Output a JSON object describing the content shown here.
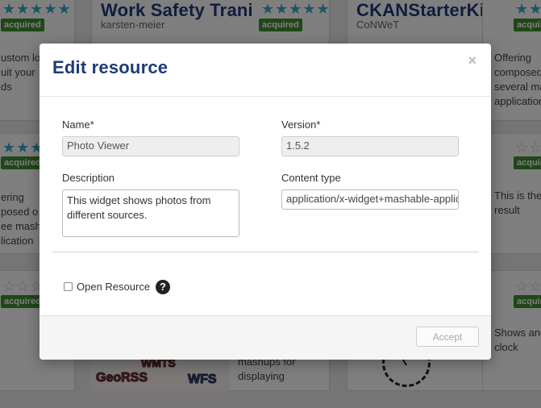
{
  "background": {
    "cards": [
      {
        "title": "Work Safety Traning",
        "vendor": "karsten-meier",
        "badge": "acquired"
      },
      {
        "title": "CKANStarterKit",
        "vendor": "CoNWeT",
        "badge": "acquired"
      }
    ],
    "badge_left": "acquired",
    "badge_far_right": "acquired",
    "row2_badge_left": "acquired",
    "row2_badge_right": "acquired",
    "row3_badge_left": "acquired",
    "row3_badge_right": "acquired",
    "desc_left_top": "ustom lo\nuit your\nds",
    "desc_right_top": "Offering\ncomposed\nseveral ma\napplication",
    "desc_left_mid": "ering\nposed o\nee mashu\nlication",
    "desc_right_mid": "This is the\nresult",
    "desc_center_bottom": "mashups for\ndisplaying",
    "desc_right_bottom": "Shows and\nclock",
    "thumb_words": [
      "WMTS",
      "GeoRSS",
      "WFS"
    ]
  },
  "modal": {
    "title": "Edit resource",
    "close": "×",
    "name_label": "Name*",
    "name_value": "Photo Viewer",
    "version_label": "Version*",
    "version_value": "1.5.2",
    "description_label": "Description",
    "description_value": "This widget shows photos from\ndifferent sources.",
    "content_type_label": "Content type",
    "content_type_value": "application/x-widget+mashable-application-component",
    "open_resource_label": "Open Resource",
    "help_icon": "?",
    "accept_label": "Accept"
  },
  "colors": {
    "title": "#1d3b78",
    "badge": "#3e8e2f",
    "stars": "#34aac6"
  }
}
